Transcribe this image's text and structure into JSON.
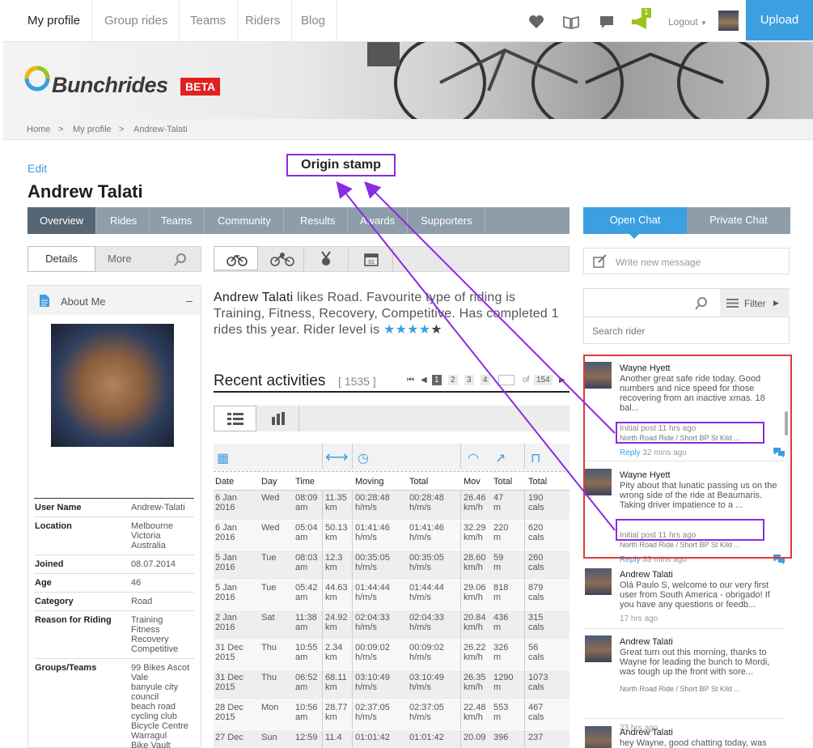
{
  "nav": {
    "items": [
      "My profile",
      "Group rides",
      "Teams",
      "Riders",
      "Blog"
    ],
    "notif_count": "1",
    "logout": "Logout",
    "upload": "Upload"
  },
  "brand": {
    "name": "Bunchrides",
    "badge": "BETA"
  },
  "breadcrumb": [
    "Home",
    ">",
    "My profile",
    ">",
    "Andrew-Talati"
  ],
  "profile": {
    "edit": "Edit",
    "name": "Andrew Talati",
    "tabs": [
      "Overview",
      "Rides",
      "Teams",
      "Community",
      "Results",
      "Awards",
      "Supporters"
    ],
    "details_label": "Details",
    "more_label": "More",
    "about_title": "About Me",
    "about_toggle": "–",
    "info": [
      {
        "label": "User Name",
        "value": "Andrew-Talati"
      },
      {
        "label": "Location",
        "value": "Melbourne\nVictoria\nAustralia"
      },
      {
        "label": "Joined",
        "value": "08.07.2014"
      },
      {
        "label": "Age",
        "value": "46"
      },
      {
        "label": "Category",
        "value": "Road"
      },
      {
        "label": "Reason for Riding",
        "value": "Training\nFitness\nRecovery\nCompetitive"
      },
      {
        "label": "Groups/Teams",
        "value": "99 Bikes Ascot\nVale\nbanyule city\ncouncil\nbeach road\ncycling club\nBicycle Centre\nWarragul\nBike Vault"
      }
    ],
    "bio_name": "Andrew Talati",
    "bio_text": " likes Road. Favourite type of riding is Training, Fitness, Recovery, Competitive. Has completed 1 rides this year. Rider level is ",
    "rating": 4,
    "rating_max": 5
  },
  "activities": {
    "title": "Recent activities",
    "count": "[ 1535 ]",
    "pages": [
      "1",
      "2",
      "3",
      "4"
    ],
    "of_label": "of",
    "total_pages": "154",
    "headers": [
      "Date",
      "Day",
      "Time",
      "",
      "Moving",
      "Total",
      "Mov",
      "Total",
      "Total"
    ],
    "rows": [
      [
        "6 Jan\n2016",
        "Wed",
        "08:09\nam",
        "11.35\nkm",
        "00:28:48\nh/m/s",
        "00:28:48\nh/m/s",
        "26.46\nkm/h",
        "47\nm",
        "190\ncals"
      ],
      [
        "6 Jan\n2016",
        "Wed",
        "05:04\nam",
        "50.13\nkm",
        "01:41:46\nh/m/s",
        "01:41:46\nh/m/s",
        "32.29\nkm/h",
        "220\nm",
        "620\ncals"
      ],
      [
        "5 Jan\n2016",
        "Tue",
        "08:03\nam",
        "12.3\nkm",
        "00:35:05\nh/m/s",
        "00:35:05\nh/m/s",
        "28.60\nkm/h",
        "59\nm",
        "260\ncals"
      ],
      [
        "5 Jan\n2016",
        "Tue",
        "05:42\nam",
        "44.63\nkm",
        "01:44:44\nh/m/s",
        "01:44:44\nh/m/s",
        "29.06\nkm/h",
        "818\nm",
        "879\ncals"
      ],
      [
        "2 Jan\n2016",
        "Sat",
        "11:38\nam",
        "24.92\nkm",
        "02:04:33\nh/m/s",
        "02:04:33\nh/m/s",
        "20.84\nkm/h",
        "436\nm",
        "315\ncals"
      ],
      [
        "31 Dec\n2015",
        "Thu",
        "10:55\nam",
        "2.34\nkm",
        "00:09:02\nh/m/s",
        "00:09:02\nh/m/s",
        "26.22\nkm/h",
        "326\nm",
        "56\ncals"
      ],
      [
        "31 Dec\n2015",
        "Thu",
        "06:52\nam",
        "68.11\nkm",
        "03:10:49\nh/m/s",
        "03:10:49\nh/m/s",
        "26.35\nkm/h",
        "1290\nm",
        "1073\ncals"
      ],
      [
        "28 Dec\n2015",
        "Mon",
        "10:56\nam",
        "28.77\nkm",
        "02:37:05\nh/m/s",
        "02:37:05\nh/m/s",
        "22.48\nkm/h",
        "553\nm",
        "467\ncals"
      ],
      [
        "27 Dec",
        "Sun",
        "12:59",
        "11.4",
        "01:01:42",
        "01:01:42",
        "20.09",
        "396",
        "237"
      ]
    ]
  },
  "chat": {
    "open_tab": "Open Chat",
    "private_tab": "Private Chat",
    "new_msg_placeholder": "Write new message",
    "filter": "Filter",
    "search_placeholder": "Search rider",
    "posts": [
      {
        "name": "Wayne Hyett",
        "body": "Another great safe ride today. Good numbers and nice speed for those recovering from an inactive xmas. 18 bal...",
        "meta1": "Initial post 11 hrs ago",
        "meta2": "North Road Ride / Short BP St Kild ...",
        "reply": "Reply",
        "ago": "32 mins ago"
      },
      {
        "name": "Wayne Hyett",
        "body": "Pity about that lunatic passing us on the wrong side of the ride at Beaumaris. Taking driver impatience to a ...",
        "meta1": "Initial post 11 hrs ago",
        "meta2": "North Road Ride / Short BP St Kild ...",
        "reply": "Reply",
        "ago": "33 mins ago"
      },
      {
        "name": "Andrew Talati",
        "body": "Olá Paulo S, welcome to our very first user from South America - obrigado! If you have any questions or feedb...",
        "ago": "17 hrs ago"
      },
      {
        "name": "Andrew Talati",
        "body": "Great turn out this morning, thanks to Wayne for leading the bunch to Mordi, was tough up the front with sore...",
        "meta2": "North Road Ride / Short BP St Kild ...",
        "ago": "23 hrs ago"
      },
      {
        "name": "Andrew Talati",
        "body": "hey Wayne, good chatting today, was"
      }
    ]
  },
  "annotation": {
    "label": "Origin stamp"
  },
  "colors": {
    "accent": "#3b9fe0",
    "tabbar": "#8d9daa",
    "tab_active": "#556674",
    "highlight": "#e03a3a",
    "annotation": "#8a2be2"
  }
}
